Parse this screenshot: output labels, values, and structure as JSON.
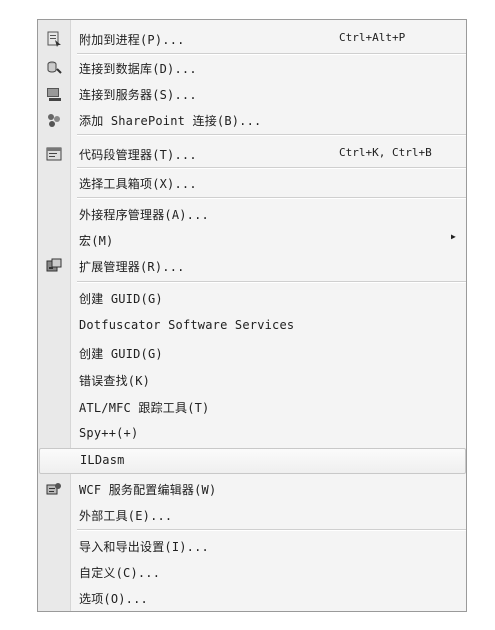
{
  "menu": {
    "items": [
      {
        "label": "附加到进程(P)...",
        "shortcut": "Ctrl+Alt+P",
        "icon": "attach-process-icon"
      },
      {
        "label": "连接到数据库(D)...",
        "icon": "connect-database-icon"
      },
      {
        "label": "连接到服务器(S)...",
        "icon": "connect-server-icon"
      },
      {
        "label": "添加 SharePoint 连接(B)...",
        "icon": "sharepoint-icon"
      },
      {
        "label": "代码段管理器(T)...",
        "shortcut": "Ctrl+K, Ctrl+B",
        "icon": "code-snippets-icon"
      },
      {
        "label": "选择工具箱项(X)..."
      },
      {
        "label": "外接程序管理器(A)..."
      },
      {
        "label": "宏(M)",
        "submenu": true
      },
      {
        "label": "扩展管理器(R)...",
        "icon": "extension-manager-icon"
      },
      {
        "label": "创建 GUID(G)"
      },
      {
        "label": "Dotfuscator Software Services"
      },
      {
        "label": "创建 GUID(G)"
      },
      {
        "label": "错误查找(K)"
      },
      {
        "label": "ATL/MFC 跟踪工具(T)"
      },
      {
        "label": "Spy++(+)"
      },
      {
        "label": "ILDasm",
        "highlighted": true
      },
      {
        "label": "WCF 服务配置编辑器(W)",
        "icon": "wcf-config-icon"
      },
      {
        "label": "外部工具(E)..."
      },
      {
        "label": "导入和导出设置(I)..."
      },
      {
        "label": "自定义(C)..."
      },
      {
        "label": "选项(O)..."
      }
    ]
  }
}
